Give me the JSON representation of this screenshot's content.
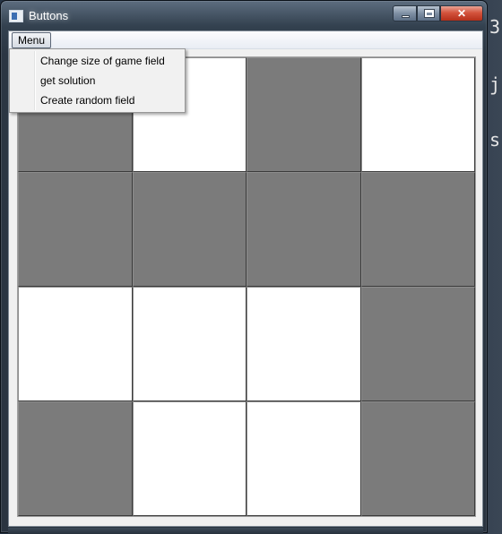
{
  "window": {
    "title": "Buttons",
    "icon": "app-window-icon",
    "controls": {
      "minimize": "minimize-icon",
      "maximize": "maximize-icon",
      "close_label": "✕"
    }
  },
  "menubar": {
    "menu_label": "Menu"
  },
  "dropdown": {
    "items": [
      {
        "label": "Change size of game field"
      },
      {
        "label": "get solution"
      },
      {
        "label": "Create random field"
      }
    ]
  },
  "game_field": {
    "rows": 4,
    "cols": 4,
    "colors": {
      "on": "#7b7b7b",
      "off": "#ffffff"
    },
    "cells": [
      [
        "on",
        "off",
        "on",
        "off"
      ],
      [
        "on",
        "on",
        "on",
        "on"
      ],
      [
        "off",
        "off",
        "off",
        "on"
      ],
      [
        "on",
        "off",
        "off",
        "on"
      ]
    ]
  },
  "background": {
    "fragments": [
      "3",
      "j",
      "s"
    ]
  }
}
